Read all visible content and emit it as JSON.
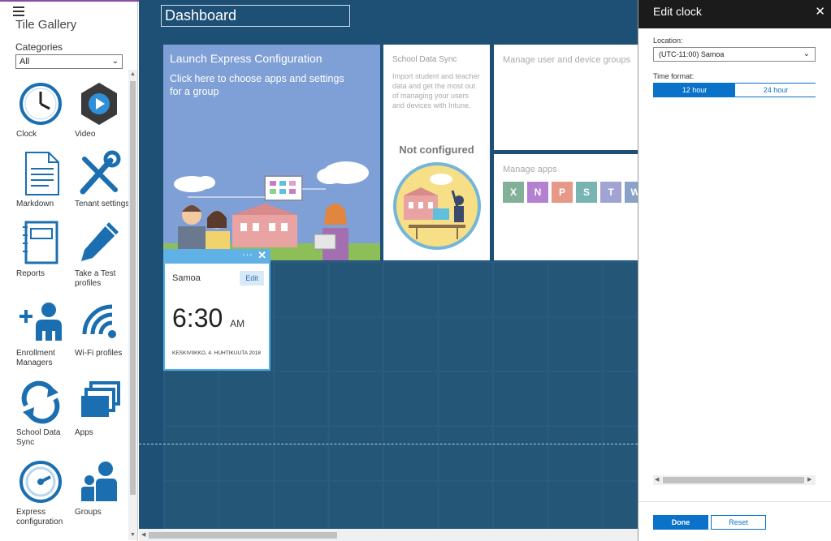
{
  "gallery": {
    "title": "Tile Gallery",
    "categories_label": "Categories",
    "categories_value": "All",
    "items": [
      {
        "label": "Clock",
        "icon": "clock-icon"
      },
      {
        "label": "Video",
        "icon": "video-icon"
      },
      {
        "label": "Markdown",
        "icon": "markdown-icon"
      },
      {
        "label": "Tenant settings",
        "icon": "tenant-settings-icon"
      },
      {
        "label": "Reports",
        "icon": "reports-icon"
      },
      {
        "label": "Take a Test profiles",
        "icon": "take-a-test-icon"
      },
      {
        "label": "Enrollment Managers",
        "icon": "enrollment-managers-icon"
      },
      {
        "label": "Wi-Fi profiles",
        "icon": "wifi-icon"
      },
      {
        "label": "School Data Sync",
        "icon": "sync-icon"
      },
      {
        "label": "Apps",
        "icon": "apps-icon"
      },
      {
        "label": "Express configuration",
        "icon": "express-config-icon"
      },
      {
        "label": "Groups",
        "icon": "groups-icon"
      }
    ]
  },
  "dashboard": {
    "title": "Dashboard",
    "launch_tile": {
      "heading": "Launch Express Configuration",
      "subtext": "Click here to choose apps and settings for a group"
    },
    "sds_tile": {
      "heading": "School Data Sync",
      "description": "Import student and teacher data and get the most out of managing your users and devices with Intune.",
      "status": "Not configured"
    },
    "groups_tile": {
      "heading": "Manage user and device groups"
    },
    "apps_tile": {
      "heading": "Manage apps",
      "apps": [
        {
          "letter": "X",
          "color": "#1e7145"
        },
        {
          "letter": "N",
          "color": "#7719aa"
        },
        {
          "letter": "P",
          "color": "#d24726"
        },
        {
          "letter": "S",
          "color": "#0b7a75"
        },
        {
          "letter": "T",
          "color": "#5558af"
        },
        {
          "letter": "W",
          "color": "#2b579a"
        }
      ]
    },
    "clock_tile": {
      "city": "Samoa",
      "edit_label": "Edit",
      "time": "6:30",
      "ampm": "AM",
      "date": "KESKIVIIKKO, 4. HUHTIKUUTA 2018",
      "dots": "···",
      "close": "✕"
    }
  },
  "edit_panel": {
    "title": "Edit clock",
    "close": "✕",
    "location_label": "Location:",
    "location_value": "(UTC-11:00) Samoa",
    "time_format_label": "Time format:",
    "format_12": "12 hour",
    "format_24": "24 hour",
    "selected_format": "12 hour",
    "done_label": "Done",
    "reset_label": "Reset"
  },
  "colors": {
    "dashboard_bg": "#1e4f74",
    "accent": "#0a72c9",
    "tile_launch_bg": "#7fa0d6",
    "clock_header": "#5fb1e6"
  }
}
